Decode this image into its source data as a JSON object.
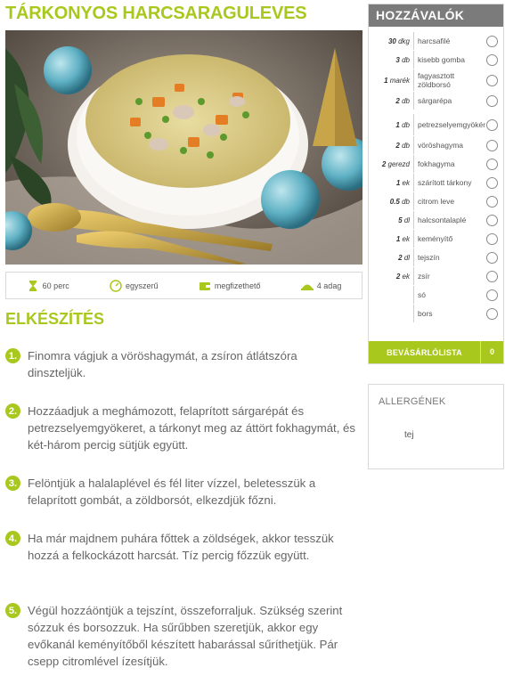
{
  "recipe": {
    "title": "TÁRKONYOS HARCSARAGULEVES",
    "image_alt": "soup-photo"
  },
  "info": [
    {
      "icon": "hourglass-icon",
      "label": "60 perc"
    },
    {
      "icon": "difficulty-icon",
      "label": "egyszerű"
    },
    {
      "icon": "wallet-icon",
      "label": "megfizethető"
    },
    {
      "icon": "dish-icon",
      "label": "4 adag"
    }
  ],
  "preparation": {
    "title": "ELKÉSZÍTÉS",
    "steps": [
      {
        "num": "1.",
        "text": "Finomra vágjuk a vöröshagymát, a zsíron átlátszóra dinszteljük."
      },
      {
        "num": "2.",
        "text": "Hozzáadjuk a meghámozott, felaprított sárgarépát és petrezselyemgyökeret, a tárkonyt meg az áttört fokhagymát, és két-három percig sütjük együtt."
      },
      {
        "num": "3.",
        "text": "Felöntjük a halalaplével és fél liter vízzel, beletesszük a felaprított gombát, a zöldborsót, elkezdjük főzni."
      },
      {
        "num": "4.",
        "text": "Ha már majdnem puhára főttek a zöldségek, akkor tesszük hozzá a felkockázott harcsát. Tíz percig főzzük együtt."
      },
      {
        "num": "5.",
        "text": "Végül hozzáöntjük a tejszínt, összeforraljuk. Szükség szerint sózzuk és borsozzuk. Ha sűrűbben szeretjük, akkor egy evőkanál keményítőből készített habarással sűríthetjük. Pár csepp citromlével ízesítjük."
      }
    ]
  },
  "ingredients": {
    "title": "HOZZÁVALÓK",
    "items": [
      {
        "amount": "30",
        "unit": "dkg",
        "name": "harcsafilé"
      },
      {
        "amount": "3",
        "unit": "db",
        "name": "kisebb gomba"
      },
      {
        "amount": "1",
        "unit": "marék",
        "name": "fagyasztott zöldborsó"
      },
      {
        "amount": "2",
        "unit": "db",
        "name": "sárgarépa"
      },
      {
        "amount": "1",
        "unit": "db",
        "name": "petrezselyemgyökér"
      },
      {
        "amount": "2",
        "unit": "db",
        "name": "vöröshagyma"
      },
      {
        "amount": "2",
        "unit": "gerezd",
        "name": "fokhagyma"
      },
      {
        "amount": "1",
        "unit": "ek",
        "name": "szárított tárkony"
      },
      {
        "amount": "0.5",
        "unit": "db",
        "name": "citrom leve"
      },
      {
        "amount": "5",
        "unit": "dl",
        "name": "halcsontalaplé"
      },
      {
        "amount": "1",
        "unit": "ek",
        "name": "keményítő"
      },
      {
        "amount": "2",
        "unit": "dl",
        "name": "tejszín"
      },
      {
        "amount": "2",
        "unit": "ek",
        "name": "zsír"
      },
      {
        "amount": "",
        "unit": "",
        "name": "só"
      },
      {
        "amount": "",
        "unit": "",
        "name": "bors"
      }
    ],
    "shopping_list_label": "BEVÁSÁRLÓLISTA",
    "shopping_list_count": "0"
  },
  "allergens": {
    "title": "ALLERGÉNEK",
    "items": [
      "tej"
    ]
  },
  "colors": {
    "accent": "#a8c81e",
    "header_gray": "#7b7b7b"
  }
}
